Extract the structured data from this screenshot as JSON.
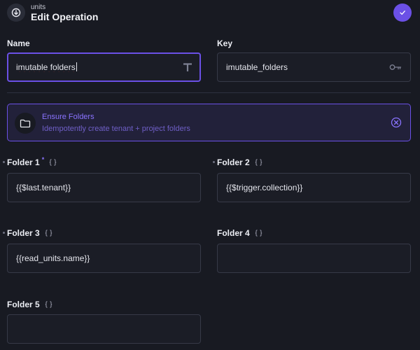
{
  "header": {
    "subtitle": "units",
    "title": "Edit Operation",
    "confirm_icon": "check-icon",
    "back_icon": "circle-arrow-icon"
  },
  "name_field": {
    "label": "Name",
    "value": "imutable folders",
    "icon": "text-type-icon"
  },
  "key_field": {
    "label": "Key",
    "value": "imutable_folders",
    "icon": "key-icon"
  },
  "operation": {
    "title": "Ensure Folders",
    "description": "Idempotently create tenant + project folders",
    "icon": "folder-icon",
    "close_icon": "close-circle-icon"
  },
  "folders": [
    {
      "label": "Folder 1",
      "required_mark": "*",
      "value": "{{$last.tenant}}"
    },
    {
      "label": "Folder 2",
      "value": "{{$trigger.collection}}"
    },
    {
      "label": "Folder 3",
      "value": "{{read_units.name}}"
    },
    {
      "label": "Folder 4",
      "value": ""
    },
    {
      "label": "Folder 5",
      "value": ""
    }
  ],
  "colors": {
    "accent": "#6b50e6",
    "background": "#181a22",
    "card_background": "#22213a"
  }
}
